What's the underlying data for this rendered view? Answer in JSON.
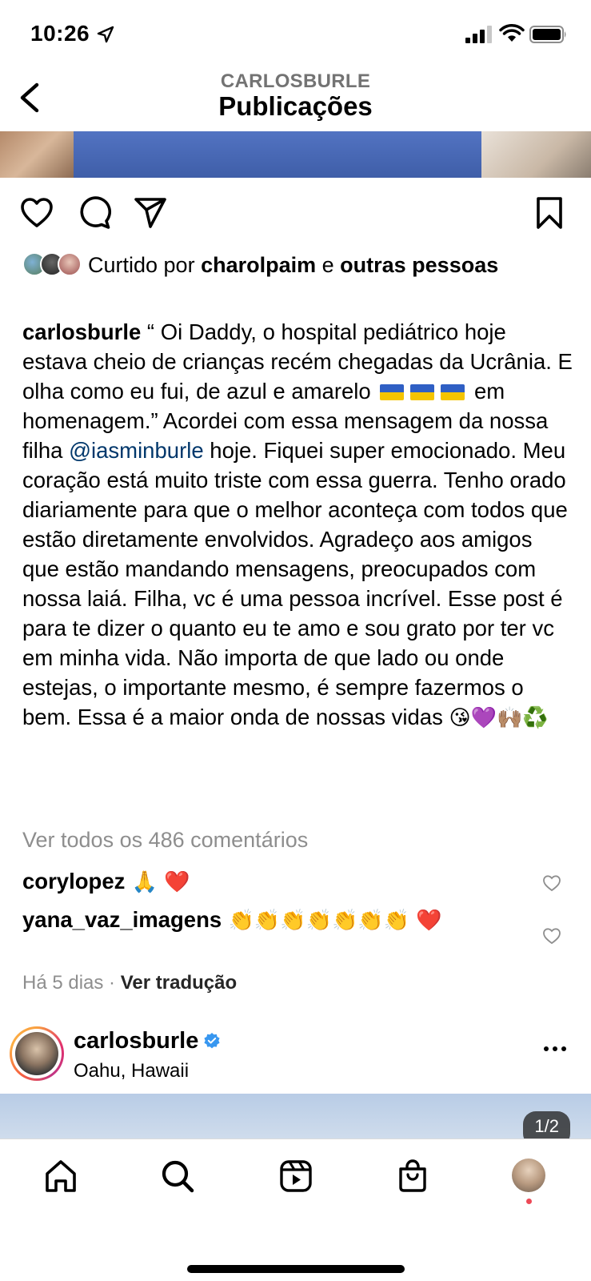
{
  "status_bar": {
    "time": "10:26"
  },
  "header": {
    "account": "CARLOSBURLE",
    "title": "Publicações"
  },
  "likes": {
    "prefix": "Curtido por ",
    "user": "charolpaim",
    "connector": " e ",
    "others": "outras pessoas"
  },
  "caption": {
    "username": "carlosburle",
    "text_1": " “ Oi Daddy, o hospital pediátrico hoje estava cheio de crianças recém chegadas da Ucrânia. E olha como eu fui, de azul e amarelo ",
    "text_2": " em homenagem.” Acordei com essa mensagem da nossa filha ",
    "mention": "@iasminburle",
    "text_3": " hoje. Fiquei super emocionado. Meu coração está muito triste com essa guerra. Tenho orado diariamente para que o melhor aconteça com todos que estão diretamente envolvidos. Agradeço aos amigos que estão mandando mensagens, preocupados com nossa laiá. Filha, vc é uma pessoa incrível. Esse post é para te dizer o quanto eu te amo e sou grato por ter vc em minha vida. Não importa de que lado ou onde estejas, o importante mesmo, é sempre fazermos o bem. Essa é a maior onda de nossas vidas ",
    "end_emojis": "😘💜🙌🏽♻️"
  },
  "view_comments": "Ver todos os 486 comentários",
  "comments": [
    {
      "user": "corylopez",
      "text": " 🙏 ❤️"
    },
    {
      "user": "yana_vaz_imagens",
      "text": " 👏👏👏👏👏👏👏 ❤️"
    }
  ],
  "meta": {
    "time_ago": "Há 5 dias",
    "separator": " · ",
    "translate": "Ver tradução"
  },
  "next_post": {
    "username": "carlosburle",
    "location": "Oahu, Hawaii",
    "counter": "1/2"
  },
  "icons": {
    "back": "chevron-left-icon",
    "like": "heart-icon",
    "comment": "comment-icon",
    "share": "paper-plane-icon",
    "save": "bookmark-icon",
    "home": "home-icon",
    "search": "search-icon",
    "reels": "reels-icon",
    "shop": "shop-icon"
  },
  "colors": {
    "link": "#00376b",
    "muted": "#8e8e8e",
    "notification": "#ed4956",
    "verified": "#3897f0"
  }
}
